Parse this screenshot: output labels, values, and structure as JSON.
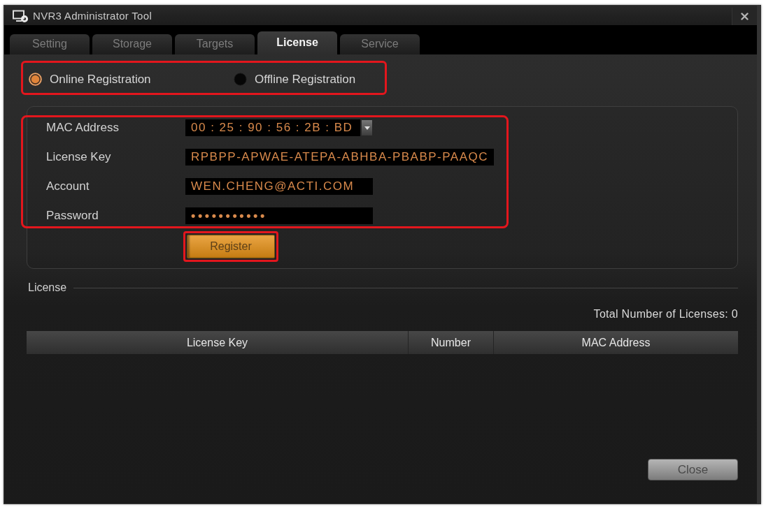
{
  "window": {
    "title": "NVR3 Administrator Tool"
  },
  "tabs": [
    {
      "label": "Setting",
      "selected": false
    },
    {
      "label": "Storage",
      "selected": false
    },
    {
      "label": "Targets",
      "selected": false
    },
    {
      "label": "License",
      "selected": true
    },
    {
      "label": "Service",
      "selected": false
    }
  ],
  "registration": {
    "highlighted": true,
    "options": [
      {
        "label": "Online Registration",
        "selected": true
      },
      {
        "label": "Offline Registration",
        "selected": false
      }
    ]
  },
  "form": {
    "highlighted": true,
    "fields": [
      {
        "label": "MAC Address",
        "kind": "combo",
        "value": "00 : 25 : 90 : 56 : 2B : BD"
      },
      {
        "label": "License Key",
        "kind": "text",
        "value": "RPBPP-APWAE-ATEPA-ABHBA-PBABP-PAAQC"
      },
      {
        "label": "Account",
        "kind": "text",
        "value": "WEN.CHENG@ACTI.COM"
      },
      {
        "label": "Password",
        "kind": "password",
        "value": "•••••••••••"
      }
    ]
  },
  "register_button": {
    "label": "Register",
    "highlighted": true
  },
  "license": {
    "title": "License",
    "total": "Total Number of Licenses: 0",
    "table": {
      "columns": [
        "License Key",
        "Number",
        "MAC Address"
      ]
    }
  },
  "close_button": "Close"
}
